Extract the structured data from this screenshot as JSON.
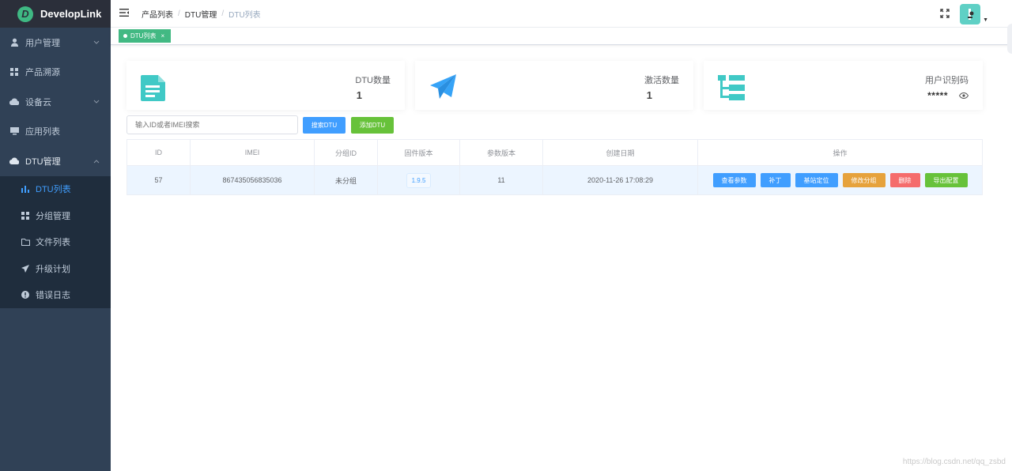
{
  "app": {
    "logo_letter": "D",
    "name": "DevelopLink"
  },
  "sidebar": {
    "items": [
      {
        "label": "用户管理",
        "icon": "user-icon",
        "expandable": true
      },
      {
        "label": "产品溯源",
        "icon": "grid-icon",
        "expandable": false
      },
      {
        "label": "设备云",
        "icon": "cloud-icon",
        "expandable": true
      },
      {
        "label": "应用列表",
        "icon": "monitor-icon",
        "expandable": false
      },
      {
        "label": "DTU管理",
        "icon": "cloud-icon",
        "expandable": true,
        "expanded": true
      }
    ],
    "subitems": [
      {
        "label": "DTU列表",
        "icon": "bar-chart-icon",
        "active": true
      },
      {
        "label": "分组管理",
        "icon": "grid-icon"
      },
      {
        "label": "文件列表",
        "icon": "folder-icon"
      },
      {
        "label": "升级计划",
        "icon": "send-icon"
      },
      {
        "label": "错误日志",
        "icon": "alert-icon"
      }
    ]
  },
  "breadcrumb": [
    "产品列表",
    "DTU管理",
    "DTU列表"
  ],
  "tags": [
    {
      "label": "DTU列表",
      "close": "×"
    }
  ],
  "cards": [
    {
      "label": "DTU数量",
      "value": "1",
      "icon": "document-icon",
      "color": "#40c9c6"
    },
    {
      "label": "激活数量",
      "value": "1",
      "icon": "paper-plane-icon",
      "color": "#36a3f7"
    },
    {
      "label": "用户识别码",
      "value": "*****",
      "icon": "tree-icon",
      "color": "#40c9c6"
    }
  ],
  "filter": {
    "search_placeholder": "输入ID或者IMEI搜索",
    "search_button": "搜索DTU",
    "add_button": "添加DTU"
  },
  "table": {
    "columns": [
      "ID",
      "IMEI",
      "分组ID",
      "固件版本",
      "参数版本",
      "创建日期",
      "操作"
    ],
    "rows": [
      {
        "id": "57",
        "imei": "867435056835036",
        "group": "未分组",
        "firmware": "1.9.5",
        "param": "11",
        "created": "2020-11-26 17:08:29"
      }
    ],
    "actions": [
      {
        "label": "查看参数",
        "color": "#409eff"
      },
      {
        "label": "补丁",
        "color": "#409eff"
      },
      {
        "label": "基站定位",
        "color": "#409eff"
      },
      {
        "label": "修改分组",
        "color": "#e6a23c"
      },
      {
        "label": "删除",
        "color": "#f56c6c"
      },
      {
        "label": "导出配置",
        "color": "#67c23a"
      }
    ]
  },
  "colors": {
    "sidebar_bg": "#304156",
    "primary": "#409eff",
    "success": "#67c23a",
    "tag_active": "#42b983"
  },
  "watermark": "https://blog.csdn.net/qq_zsbd"
}
